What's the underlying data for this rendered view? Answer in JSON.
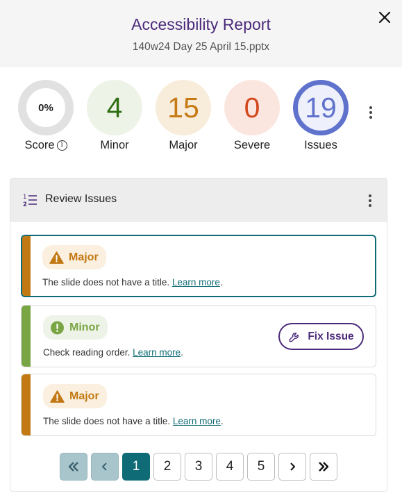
{
  "header": {
    "title": "Accessibility Report",
    "subtitle": "140w24 Day 25 April 15.pptx",
    "close_icon": "close-icon"
  },
  "stats": [
    {
      "key": "score",
      "value": "0%",
      "label": "Score",
      "has_info": true
    },
    {
      "key": "minor",
      "value": "4",
      "label": "Minor"
    },
    {
      "key": "major",
      "value": "15",
      "label": "Major"
    },
    {
      "key": "severe",
      "value": "0",
      "label": "Severe"
    },
    {
      "key": "issues",
      "value": "19",
      "label": "Issues"
    }
  ],
  "review": {
    "title": "Review Issues",
    "issues": [
      {
        "severity": "Major",
        "text": "The slide does not have a title.",
        "link": "Learn more",
        "selected": true
      },
      {
        "severity": "Minor",
        "text": "Check reading order.",
        "link": "Learn more",
        "action": "Fix Issue"
      },
      {
        "severity": "Major",
        "text": "The slide does not have a title.",
        "link": "Learn more"
      }
    ]
  },
  "pagination": {
    "pages": [
      "1",
      "2",
      "3",
      "4",
      "5"
    ],
    "current": "1",
    "first_icon": "double-chevron-left-icon",
    "prev_icon": "chevron-left-icon",
    "next_icon": "chevron-right-icon",
    "last_icon": "double-chevron-right-icon"
  },
  "colors": {
    "title": "#4b2a7b",
    "accent": "#0f6b75",
    "major": "#c27813",
    "minor": "#7aa545",
    "severe": "#d3491d",
    "issues": "#5f72cc"
  }
}
